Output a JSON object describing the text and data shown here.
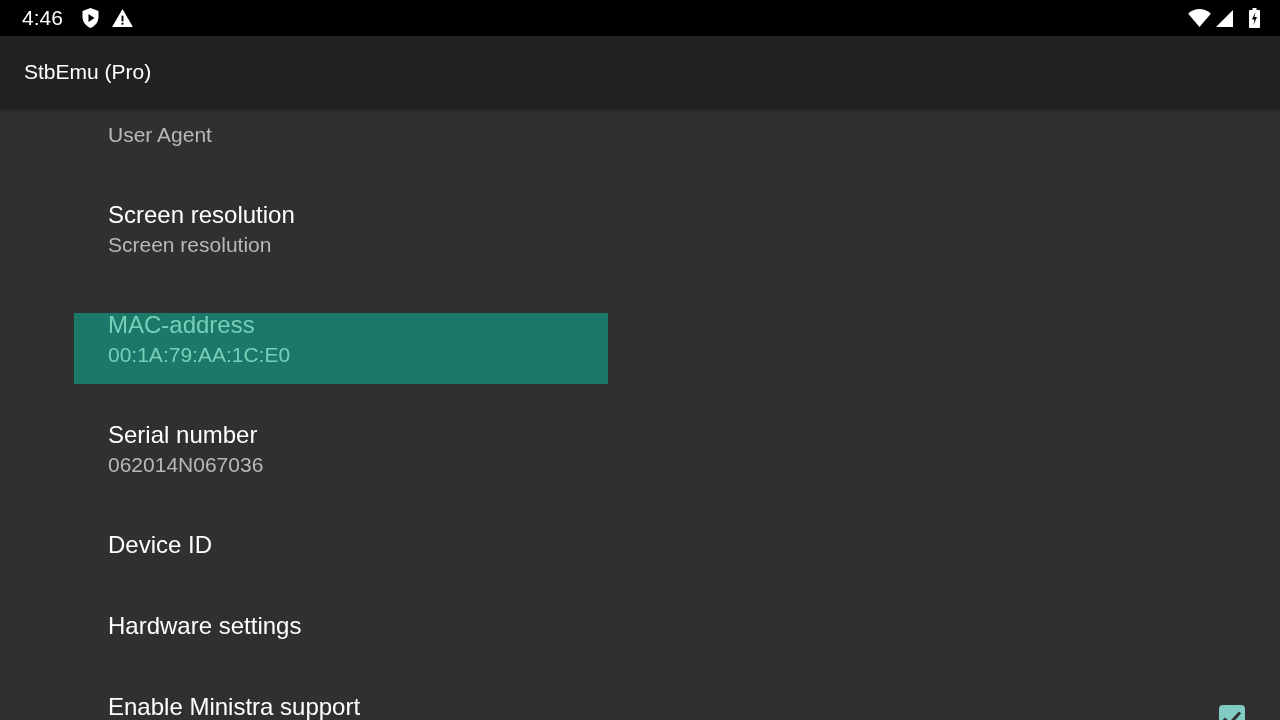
{
  "status_bar": {
    "time": "4:46"
  },
  "app_bar": {
    "title": "StbEmu (Pro)"
  },
  "preferences": [
    {
      "kind": "text",
      "summary": "User Agent",
      "selected": false
    },
    {
      "kind": "text",
      "title": "Screen resolution",
      "summary": "Screen resolution",
      "selected": false
    },
    {
      "kind": "text",
      "title": "MAC-address",
      "summary": "00:1A:79:AA:1C:E0",
      "selected": true
    },
    {
      "kind": "text",
      "title": "Serial number",
      "summary": "062014N067036",
      "selected": false
    },
    {
      "kind": "text",
      "title": "Device ID",
      "selected": false
    },
    {
      "kind": "text",
      "title": "Hardware settings",
      "selected": false
    },
    {
      "kind": "checkbox",
      "title": "Enable Ministra support",
      "checked": true,
      "selected": false
    }
  ]
}
